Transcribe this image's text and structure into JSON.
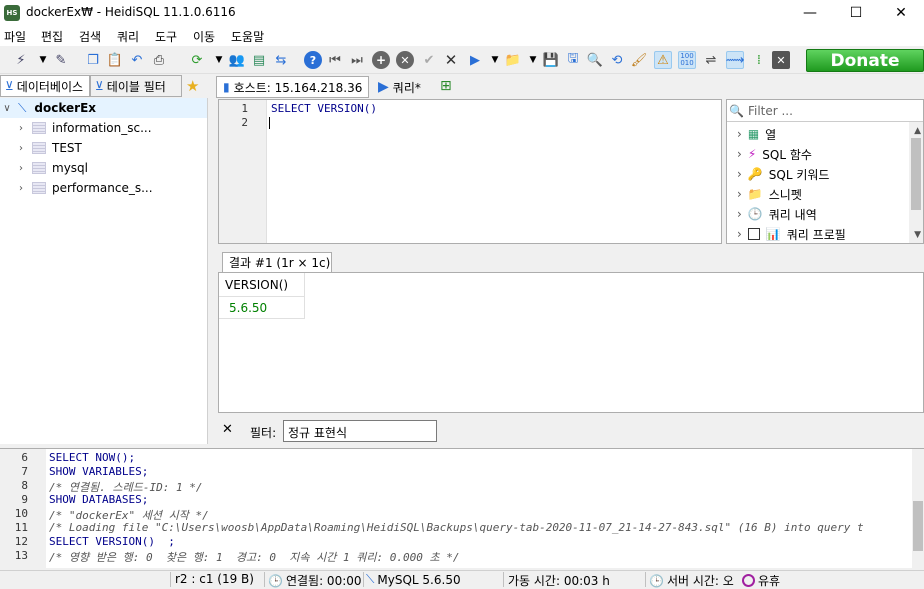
{
  "window": {
    "title": "dockerEx₩ - HeidiSQL 11.1.0.6116",
    "app_icon": "HS",
    "minimize": "—",
    "maximize": "☐",
    "close": "✕"
  },
  "menu": [
    "파일",
    "편집",
    "검색",
    "쿼리",
    "도구",
    "이동",
    "도움말"
  ],
  "toolbar": {
    "donate_label": "Donate"
  },
  "left_tabs": {
    "databases": "데이터베이스",
    "table_filter": "테이블 필터"
  },
  "tree": {
    "root": "dockerEx",
    "items": [
      "information_sc...",
      "TEST",
      "mysql",
      "performance_s..."
    ]
  },
  "query_tabs": {
    "host": "호스트: 15.164.218.36",
    "query": "쿼리*"
  },
  "editor": {
    "line_numbers": [
      "1",
      "2"
    ],
    "lines": [
      "SELECT VERSION()",
      ""
    ]
  },
  "helper": {
    "filter_placeholder": "Filter ...",
    "items": [
      "열",
      "SQL 함수",
      "SQL 키워드",
      "스니펫",
      "쿼리 내역",
      "쿼리 프로필"
    ]
  },
  "results": {
    "tab_label": "결과 #1 (1r × 1c)",
    "columns": [
      "VERSION()"
    ],
    "rows": [
      [
        "5.6.50"
      ]
    ]
  },
  "filterbar": {
    "close": "✕",
    "label": "필터:",
    "value": "정규 표현식"
  },
  "log": {
    "line_numbers": [
      "6",
      "7",
      "8",
      "9",
      "10",
      "11",
      "12",
      "13"
    ],
    "lines": [
      "SELECT NOW();",
      "SHOW VARIABLES;",
      "/* 연결됨. 스레드-ID: 1 */",
      "SHOW DATABASES;",
      "/* \"dockerEx\" 세션 시작 */",
      "/* Loading file \"C:\\Users\\woosb\\AppData\\Roaming\\HeidiSQL\\Backups\\query-tab-2020-11-07_21-14-27-843.sql\" (16 B) into query t",
      "SELECT VERSION()  ;",
      "/* 영향 받은 행: 0  찾은 행: 1  경고: 0  지속 시간 1 쿼리: 0.000 초 */"
    ]
  },
  "status": {
    "position": "r2 : c1 (19 B)",
    "connected": "연결됨: 00:00",
    "server": "MySQL 5.6.50",
    "uptime": "가동 시간: 00:03 h",
    "server_time": "서버 시간: 오",
    "idle": "유휴"
  }
}
